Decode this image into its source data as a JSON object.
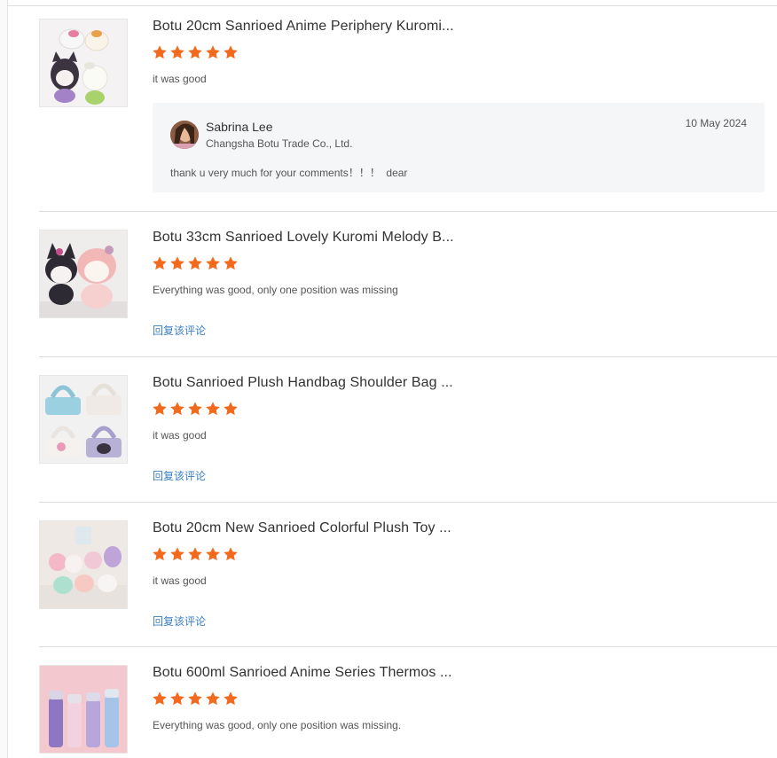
{
  "colors": {
    "star": "#f26a1e",
    "link": "#3a7fbf",
    "reply_bg": "#f5f6f8"
  },
  "reviews": [
    {
      "title": "Botu 20cm Sanrioed Anime Periphery Kuromi...",
      "rating": 5,
      "comment": "it was good",
      "thumb_icon": "kuromi-plush-photo",
      "seller_reply": {
        "name": "Sabrina Lee",
        "company": "Changsha Botu Trade Co., Ltd.",
        "date": "10 May 2024",
        "text": "thank u very much for your comments！！！  dear"
      }
    },
    {
      "title": "Botu 33cm Sanrioed Lovely Kuromi Melody B...",
      "rating": 5,
      "comment": "Everything was good, only one position was missing",
      "thumb_icon": "melody-plush-photo",
      "reply_link": "回复该评论"
    },
    {
      "title": "Botu Sanrioed Plush Handbag Shoulder Bag ...",
      "rating": 5,
      "comment": "it was good",
      "thumb_icon": "plush-handbag-photo",
      "reply_link": "回复该评论"
    },
    {
      "title": "Botu 20cm New Sanrioed Colorful Plush Toy ...",
      "rating": 5,
      "comment": "it was good",
      "thumb_icon": "colorful-plush-photo",
      "reply_link": "回复该评论"
    },
    {
      "title": "Botu 600ml Sanrioed Anime Series Thermos ...",
      "rating": 5,
      "comment": "Everything was good, only one position was missing.",
      "thumb_icon": "thermos-bottles-photo"
    }
  ]
}
